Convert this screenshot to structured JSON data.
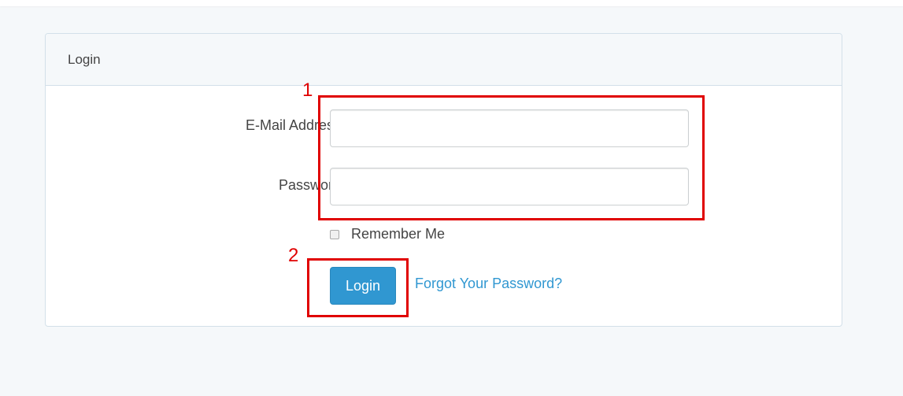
{
  "card": {
    "header_title": "Login"
  },
  "form": {
    "email_label": "E-Mail Address",
    "email_value": "",
    "password_label": "Password",
    "password_value": "",
    "remember_label": "Remember Me",
    "remember_checked": false,
    "login_label": "Login",
    "forgot_label": "Forgot Your Password?"
  },
  "annotations": {
    "marker_1": "1",
    "marker_2": "2"
  },
  "colors": {
    "primary": "#3097d1",
    "annotation": "#e00000",
    "page_bg": "#f5f8fa"
  }
}
